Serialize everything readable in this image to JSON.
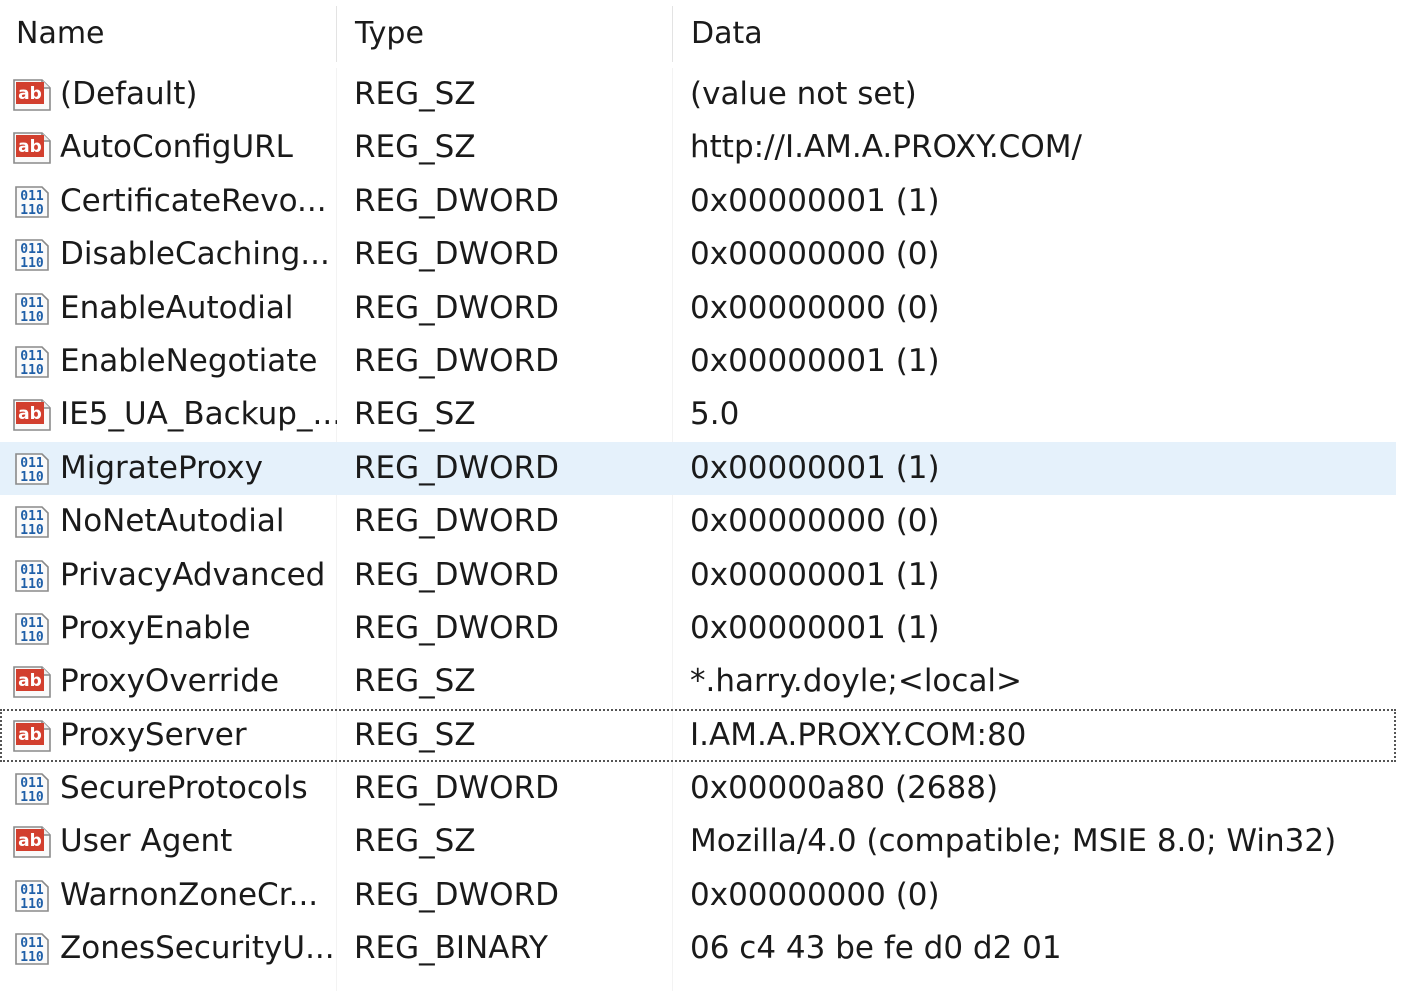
{
  "columns": {
    "name": "Name",
    "type": "Type",
    "data": "Data"
  },
  "rows": [
    {
      "icon": "string-value-icon",
      "name": "(Default)",
      "type": "REG_SZ",
      "data": "(value not set)"
    },
    {
      "icon": "string-value-icon",
      "name": "AutoConfigURL",
      "type": "REG_SZ",
      "data": "http://I.AM.A.PROXY.COM/"
    },
    {
      "icon": "binary-value-icon",
      "name": "CertificateRevo...",
      "type": "REG_DWORD",
      "data": "0x00000001 (1)"
    },
    {
      "icon": "binary-value-icon",
      "name": "DisableCaching...",
      "type": "REG_DWORD",
      "data": "0x00000000 (0)"
    },
    {
      "icon": "binary-value-icon",
      "name": "EnableAutodial",
      "type": "REG_DWORD",
      "data": "0x00000000 (0)"
    },
    {
      "icon": "binary-value-icon",
      "name": "EnableNegotiate",
      "type": "REG_DWORD",
      "data": "0x00000001 (1)"
    },
    {
      "icon": "string-value-icon",
      "name": "IE5_UA_Backup_...",
      "type": "REG_SZ",
      "data": "5.0"
    },
    {
      "icon": "binary-value-icon",
      "name": "MigrateProxy",
      "type": "REG_DWORD",
      "data": "0x00000001 (1)"
    },
    {
      "icon": "binary-value-icon",
      "name": "NoNetAutodial",
      "type": "REG_DWORD",
      "data": "0x00000000 (0)"
    },
    {
      "icon": "binary-value-icon",
      "name": "PrivacyAdvanced",
      "type": "REG_DWORD",
      "data": "0x00000001 (1)"
    },
    {
      "icon": "binary-value-icon",
      "name": "ProxyEnable",
      "type": "REG_DWORD",
      "data": "0x00000001 (1)"
    },
    {
      "icon": "string-value-icon",
      "name": "ProxyOverride",
      "type": "REG_SZ",
      "data": "*.harry.doyle;<local>"
    },
    {
      "icon": "string-value-icon",
      "name": "ProxyServer",
      "type": "REG_SZ",
      "data": "I.AM.A.PROXY.COM:80"
    },
    {
      "icon": "binary-value-icon",
      "name": "SecureProtocols",
      "type": "REG_DWORD",
      "data": "0x00000a80 (2688)"
    },
    {
      "icon": "string-value-icon",
      "name": "User Agent",
      "type": "REG_SZ",
      "data": "Mozilla/4.0 (compatible; MSIE 8.0; Win32)"
    },
    {
      "icon": "binary-value-icon",
      "name": "WarnonZoneCr...",
      "type": "REG_DWORD",
      "data": "0x00000000 (0)"
    },
    {
      "icon": "binary-value-icon",
      "name": "ZonesSecurityU...",
      "type": "REG_BINARY",
      "data": "06 c4 43 be fe d0 d2 01"
    }
  ],
  "state": {
    "hovered_row": 7,
    "focused_row": 12
  },
  "colors": {
    "hover_background": "#e5f1fb",
    "string_icon_red": "#d23f2e",
    "binary_icon_blue": "#1f5fa8"
  }
}
